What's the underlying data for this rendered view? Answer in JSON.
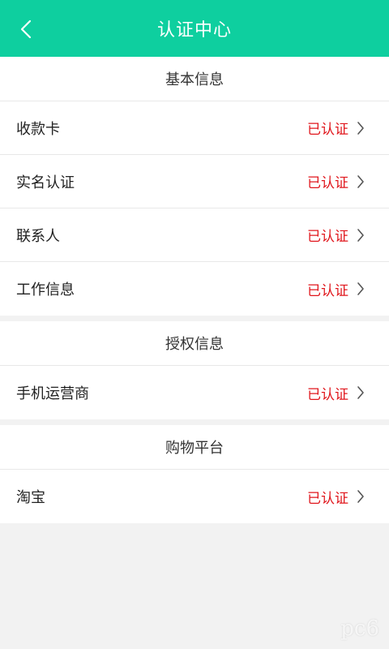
{
  "header": {
    "title": "认证中心",
    "back_icon": "chevron-left-icon"
  },
  "sections": [
    {
      "title": "基本信息",
      "items": [
        {
          "label": "收款卡",
          "status": "已认证"
        },
        {
          "label": "实名认证",
          "status": "已认证"
        },
        {
          "label": "联系人",
          "status": "已认证"
        },
        {
          "label": "工作信息",
          "status": "已认证"
        }
      ]
    },
    {
      "title": "授权信息",
      "items": [
        {
          "label": "手机运营商",
          "status": "已认证"
        }
      ]
    },
    {
      "title": "购物平台",
      "items": [
        {
          "label": "淘宝",
          "status": "已认证"
        }
      ]
    }
  ],
  "colors": {
    "header_bg": "#0ecf9f",
    "status_text": "#e0161c",
    "page_bg": "#f2f2f2"
  },
  "watermark": "pc6"
}
